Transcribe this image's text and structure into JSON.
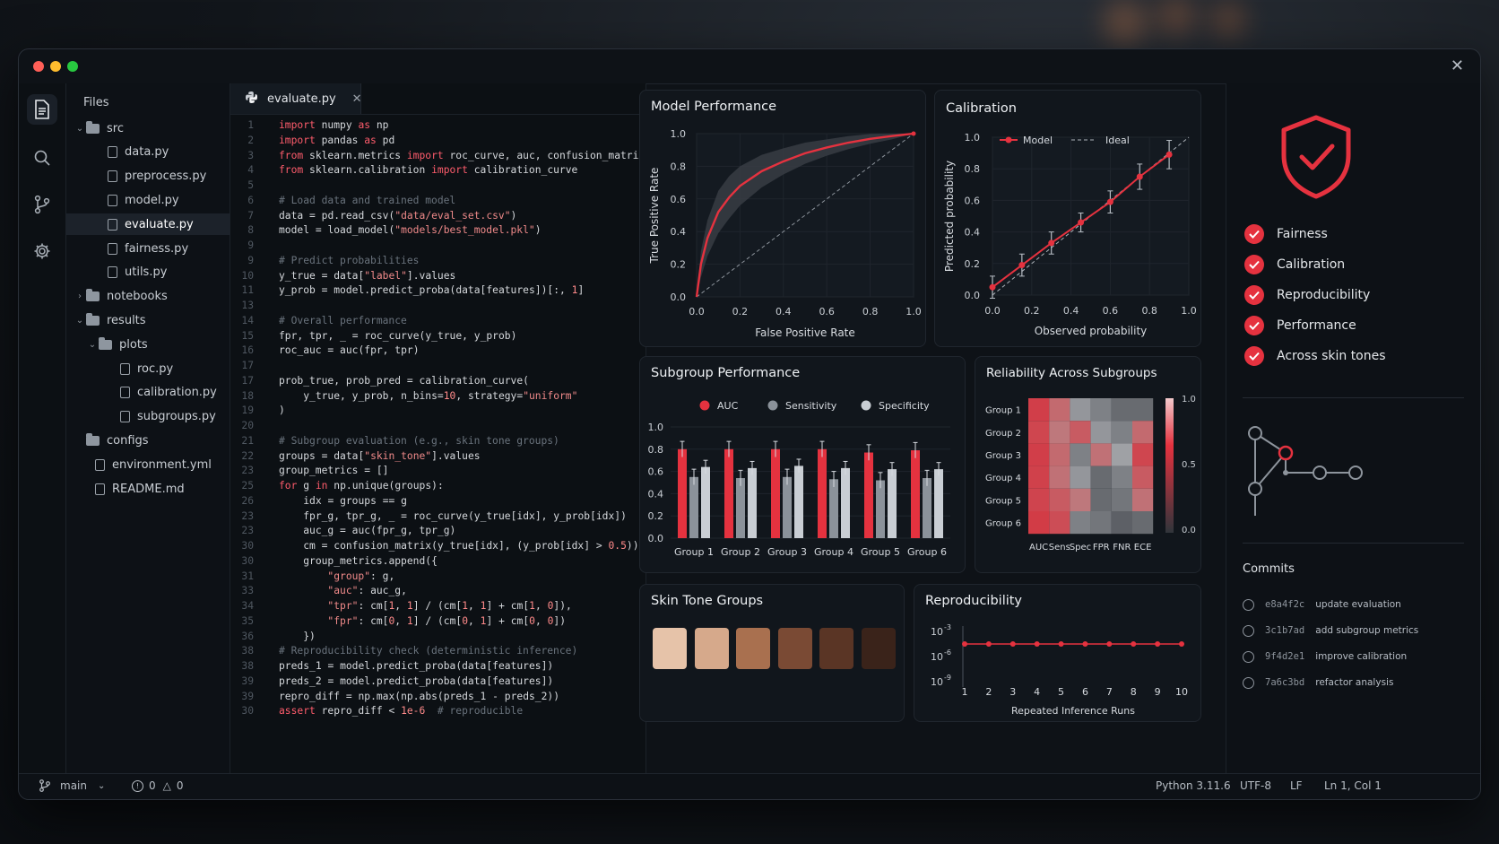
{
  "explorer": {
    "title": "Files",
    "items": [
      {
        "label": "src",
        "kind": "folder",
        "depth": 0,
        "expanded": true
      },
      {
        "label": "data.py",
        "kind": "file",
        "depth": 1
      },
      {
        "label": "preprocess.py",
        "kind": "file",
        "depth": 1
      },
      {
        "label": "model.py",
        "kind": "file",
        "depth": 1
      },
      {
        "label": "evaluate.py",
        "kind": "file",
        "depth": 1,
        "active": true
      },
      {
        "label": "fairness.py",
        "kind": "file",
        "depth": 1
      },
      {
        "label": "utils.py",
        "kind": "file",
        "depth": 1
      },
      {
        "label": "notebooks",
        "kind": "folder",
        "depth": 0,
        "expanded": false
      },
      {
        "label": "results",
        "kind": "folder",
        "depth": 0,
        "expanded": true
      },
      {
        "label": "plots",
        "kind": "folder",
        "depth": 1,
        "expanded": true
      },
      {
        "label": "roc.py",
        "kind": "file",
        "depth": 2
      },
      {
        "label": "calibration.py",
        "kind": "file",
        "depth": 2
      },
      {
        "label": "subgroups.py",
        "kind": "file",
        "depth": 2
      },
      {
        "label": "configs",
        "kind": "folder",
        "depth": 0,
        "expanded": null
      },
      {
        "label": "environment.yml",
        "kind": "file",
        "depth": 0
      },
      {
        "label": "README.md",
        "kind": "file",
        "depth": 0
      }
    ]
  },
  "editor": {
    "tab_label": "evaluate.py",
    "code_lines": [
      {
        "n": "1",
        "t": "import numpy as np"
      },
      {
        "n": "2",
        "t": "import pandas as pd"
      },
      {
        "n": "3",
        "t": "from sklearn.metrics import roc_curve, auc, confusion_matrix"
      },
      {
        "n": "4",
        "t": "from sklearn.calibration import calibration_curve"
      },
      {
        "n": "5",
        "t": ""
      },
      {
        "n": "6",
        "t": "# Load data and trained model"
      },
      {
        "n": "7",
        "t": "data = pd.read_csv(\"data/eval_set.csv\")"
      },
      {
        "n": "8",
        "t": "model = load_model(\"models/best_model.pkl\")"
      },
      {
        "n": "9",
        "t": ""
      },
      {
        "n": "9",
        "t": "# Predict probabilities"
      },
      {
        "n": "10",
        "t": "y_true = data[\"label\"].values"
      },
      {
        "n": "11",
        "t": "y_prob = model.predict_proba(data[features])[:, 1]"
      },
      {
        "n": "13",
        "t": ""
      },
      {
        "n": "14",
        "t": "# Overall performance"
      },
      {
        "n": "15",
        "t": "fpr, tpr, _ = roc_curve(y_true, y_prob)"
      },
      {
        "n": "16",
        "t": "roc_auc = auc(fpr, tpr)"
      },
      {
        "n": "17",
        "t": ""
      },
      {
        "n": "17",
        "t": "prob_true, prob_pred = calibration_curve("
      },
      {
        "n": "18",
        "t": "    y_true, y_prob, n_bins=10, strategy=\"uniform\""
      },
      {
        "n": "19",
        "t": ")"
      },
      {
        "n": "20",
        "t": ""
      },
      {
        "n": "21",
        "t": "# Subgroup evaluation (e.g., skin tone groups)"
      },
      {
        "n": "22",
        "t": "groups = data[\"skin_tone\"].values"
      },
      {
        "n": "23",
        "t": "group_metrics = []"
      },
      {
        "n": "25",
        "t": "for g in np.unique(groups):"
      },
      {
        "n": "26",
        "t": "    idx = groups == g"
      },
      {
        "n": "23",
        "t": "    fpr_g, tpr_g, _ = roc_curve(y_true[idx], y_prob[idx])"
      },
      {
        "n": "23",
        "t": "    auc_g = auc(fpr_g, tpr_g)"
      },
      {
        "n": "30",
        "t": "    cm = confusion_matrix(y_true[idx], (y_prob[idx] > 0.5))"
      },
      {
        "n": "30",
        "t": "    group_metrics.append({"
      },
      {
        "n": "31",
        "t": "        \"group\": g,"
      },
      {
        "n": "33",
        "t": "        \"auc\": auc_g,"
      },
      {
        "n": "34",
        "t": "        \"tpr\": cm[1, 1] / (cm[1, 1] + cm[1, 0]),"
      },
      {
        "n": "35",
        "t": "        \"fpr\": cm[0, 1] / (cm[0, 1] + cm[0, 0])"
      },
      {
        "n": "36",
        "t": "    })"
      },
      {
        "n": "38",
        "t": "# Reproducibility check (deterministic inference)"
      },
      {
        "n": "38",
        "t": "preds_1 = model.predict_proba(data[features])"
      },
      {
        "n": "39",
        "t": "preds_2 = model.predict_proba(data[features])"
      },
      {
        "n": "39",
        "t": "repro_diff = np.max(np.abs(preds_1 - preds_2))"
      },
      {
        "n": "30",
        "t": "assert repro_diff < 1e-6  # reproducible"
      }
    ]
  },
  "panels": {
    "model_performance": "Model Performance",
    "calibration": "Calibration",
    "subgroup_performance": "Subgroup Performance",
    "reliability": "Reliability Across Subgroups",
    "skin_tone_groups": "Skin Tone Groups",
    "reproducibility": "Reproducibility"
  },
  "skin_tones": [
    "#e6c3a9",
    "#d6a98b",
    "#a9704f",
    "#7a4a34",
    "#5a3525",
    "#3a231a"
  ],
  "checklist": [
    "Fairness",
    "Calibration",
    "Reproducibility",
    "Performance",
    "Across skin tones"
  ],
  "commits": {
    "title": "Commits",
    "items": [
      {
        "hash": "e8a4f2c",
        "message": "update evaluation"
      },
      {
        "hash": "3c1b7ad",
        "message": "add subgroup metrics"
      },
      {
        "hash": "9f4d2e1",
        "message": "improve calibration"
      },
      {
        "hash": "7a6c3bd",
        "message": "refactor analysis"
      }
    ]
  },
  "statusbar": {
    "branch": "main",
    "errors": "0",
    "warnings": "0",
    "python": "Python 3.11.6",
    "encoding": "UTF-8",
    "eol": "LF",
    "cursor": "Ln 1, Col 1"
  },
  "colors": {
    "accent": "#e5323f",
    "gray_bar": "#8b929a",
    "light_bar": "#c9ced4"
  },
  "chart_data": [
    {
      "type": "line",
      "id": "roc",
      "xlabel": "False Positive Rate",
      "ylabel": "True Positive Rate",
      "xlim": [
        0,
        1
      ],
      "ylim": [
        0,
        1
      ],
      "xticks": [
        "0.0",
        "0.2",
        "0.4",
        "0.6",
        "0.8",
        "1.0"
      ],
      "yticks": [
        "0.0",
        "0.2",
        "0.4",
        "0.6",
        "0.8",
        "1.0"
      ],
      "x": [
        0,
        0.02,
        0.05,
        0.1,
        0.15,
        0.2,
        0.3,
        0.4,
        0.5,
        0.6,
        0.7,
        0.8,
        0.9,
        1.0
      ],
      "y": [
        0,
        0.2,
        0.36,
        0.52,
        0.61,
        0.68,
        0.77,
        0.83,
        0.88,
        0.915,
        0.945,
        0.968,
        0.985,
        1.0
      ],
      "band_width": [
        0,
        0.08,
        0.11,
        0.13,
        0.13,
        0.12,
        0.1,
        0.08,
        0.065,
        0.05,
        0.04,
        0.03,
        0.02,
        0
      ],
      "diagonal": true
    },
    {
      "type": "line",
      "id": "calibration",
      "xlabel": "Observed probability",
      "ylabel": "Predicted probability",
      "xlim": [
        0,
        1
      ],
      "ylim": [
        0,
        1
      ],
      "xticks": [
        "0.0",
        "0.2",
        "0.4",
        "0.6",
        "0.8",
        "1.0"
      ],
      "yticks": [
        "0.0",
        "0.2",
        "0.4",
        "0.6",
        "0.8",
        "1.0"
      ],
      "legend": [
        "Model",
        "Ideal"
      ],
      "series": [
        {
          "name": "Model",
          "x": [
            0.0,
            0.15,
            0.3,
            0.45,
            0.6,
            0.75,
            0.9
          ],
          "y": [
            0.05,
            0.19,
            0.33,
            0.46,
            0.59,
            0.75,
            0.89
          ],
          "err": [
            0.07,
            0.07,
            0.07,
            0.06,
            0.07,
            0.08,
            0.09
          ]
        },
        {
          "name": "Ideal",
          "x": [
            0,
            1
          ],
          "y": [
            0,
            1
          ]
        }
      ]
    },
    {
      "type": "bar",
      "id": "subgroup",
      "categories": [
        "Group 1",
        "Group 2",
        "Group 3",
        "Group 4",
        "Group 5",
        "Group 6"
      ],
      "ylim": [
        0,
        1
      ],
      "yticks": [
        "0.0",
        "0.2",
        "0.4",
        "0.6",
        "0.8",
        "1.0"
      ],
      "legend": [
        "AUC",
        "Sensitivity",
        "Specificity"
      ],
      "series": [
        {
          "name": "AUC",
          "values": [
            0.8,
            0.8,
            0.8,
            0.8,
            0.77,
            0.79
          ],
          "err": [
            0.07,
            0.07,
            0.07,
            0.07,
            0.07,
            0.07
          ]
        },
        {
          "name": "Sensitivity",
          "values": [
            0.55,
            0.54,
            0.55,
            0.53,
            0.52,
            0.54
          ],
          "err": [
            0.07,
            0.07,
            0.07,
            0.07,
            0.07,
            0.07
          ]
        },
        {
          "name": "Specificity",
          "values": [
            0.64,
            0.63,
            0.65,
            0.63,
            0.62,
            0.62
          ],
          "err": [
            0.06,
            0.06,
            0.06,
            0.06,
            0.06,
            0.06
          ]
        }
      ]
    },
    {
      "type": "heatmap",
      "id": "reliability",
      "rows": [
        "Group 1",
        "Group 2",
        "Group 3",
        "Group 4",
        "Group 5",
        "Group 6"
      ],
      "cols": [
        "AUC",
        "Sens",
        "Spec",
        "FPR",
        "FNR",
        "ECE"
      ],
      "colorbar_ticks": [
        "1.0",
        "0.5",
        "0.0"
      ],
      "values": [
        [
          0.9,
          0.6,
          0.4,
          0.3,
          0.2,
          0.2
        ],
        [
          0.85,
          0.5,
          0.7,
          0.4,
          0.3,
          0.6
        ],
        [
          0.9,
          0.6,
          0.3,
          0.55,
          0.45,
          0.85
        ],
        [
          0.88,
          0.55,
          0.4,
          0.2,
          0.3,
          0.7
        ],
        [
          0.86,
          0.7,
          0.5,
          0.2,
          0.25,
          0.55
        ],
        [
          0.92,
          0.8,
          0.3,
          0.25,
          0.15,
          0.2
        ]
      ]
    },
    {
      "type": "line",
      "id": "reproducibility",
      "xlabel": "Repeated Inference Runs",
      "x": [
        1,
        2,
        3,
        4,
        5,
        6,
        7,
        8,
        9,
        10
      ],
      "y": [
        3.16e-05,
        3.16e-05,
        3.16e-05,
        3.16e-05,
        3.16e-05,
        3.16e-05,
        3.16e-05,
        3.16e-05,
        3.16e-05,
        3.16e-05
      ],
      "yscale": "log",
      "yticks": [
        "10",
        "10",
        "10"
      ],
      "ytick_exponents": [
        "-3",
        "-6",
        "-9"
      ],
      "xticks": [
        "1",
        "2",
        "3",
        "4",
        "5",
        "6",
        "7",
        "8",
        "9",
        "10"
      ]
    }
  ]
}
